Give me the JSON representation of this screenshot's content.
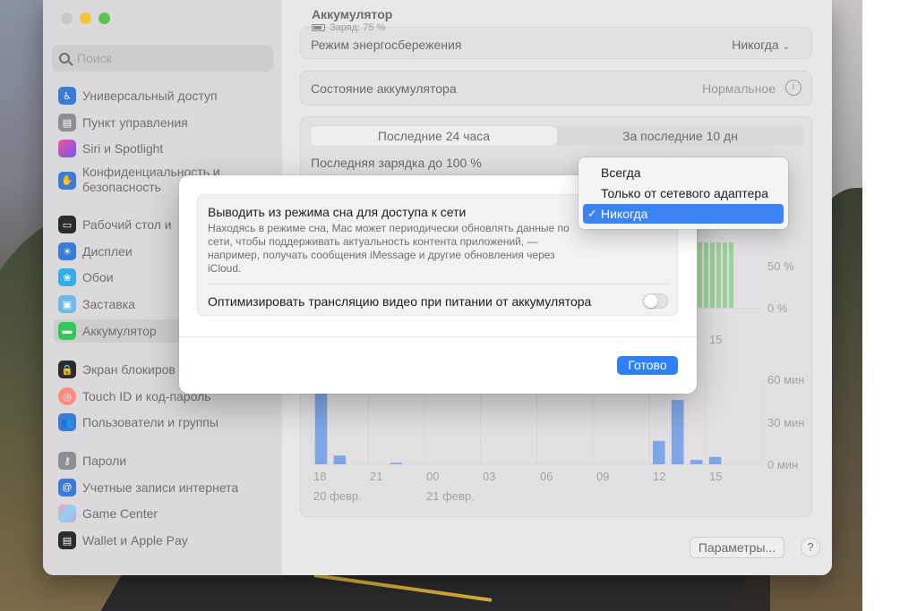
{
  "window": {
    "title": "Аккумулятор",
    "subtitle": "Заряд: 75 %"
  },
  "sidebar": {
    "search_placeholder": "Поиск",
    "items": [
      {
        "label": "Универсальный доступ",
        "icon": "accessibility-icon",
        "color": "#3a7bd5"
      },
      {
        "label": "Пункт управления",
        "icon": "control-center-icon",
        "color": "#8e8e93"
      },
      {
        "label": "Siri и Spotlight",
        "icon": "siri-icon",
        "color": "#b04ad8"
      },
      {
        "label": "Конфиденциальность и безопасность",
        "icon": "hand-icon",
        "color": "#3a7bd5"
      },
      {
        "label": "Рабочий стол и",
        "icon": "desktop-icon",
        "color": "#1c1c1e"
      },
      {
        "label": "Дисплеи",
        "icon": "display-icon",
        "color": "#3a7bd5"
      },
      {
        "label": "Обои",
        "icon": "wallpaper-icon",
        "color": "#32ade6"
      },
      {
        "label": "Заставка",
        "icon": "screensaver-icon",
        "color": "#4fa7e0"
      },
      {
        "label": "Аккумулятор",
        "icon": "battery-icon",
        "color": "#34c759"
      },
      {
        "label": "Экран блокиров",
        "icon": "lock-icon",
        "color": "#1c1c1e"
      },
      {
        "label": "Touch ID и код-пароль",
        "icon": "fingerprint-icon",
        "color": "#ff6961"
      },
      {
        "label": "Пользователи и группы",
        "icon": "users-icon",
        "color": "#3a7bd5"
      },
      {
        "label": "Пароли",
        "icon": "key-icon",
        "color": "#8e8e93"
      },
      {
        "label": "Учетные записи интернета",
        "icon": "at-icon",
        "color": "#3a7bd5"
      },
      {
        "label": "Game Center",
        "icon": "game-center-icon",
        "color": "#e96ca5"
      },
      {
        "label": "Wallet и Apple Pay",
        "icon": "wallet-icon",
        "color": "#1c1c1e"
      }
    ]
  },
  "main": {
    "low_power_label": "Режим энергосбережения",
    "low_power_value": "Никогда",
    "battery_health_label": "Состояние аккумулятора",
    "battery_health_value": "Нормальное",
    "tabs": [
      "Последние 24 часа",
      "За последние 10 дн"
    ],
    "last_charge_label": "Последняя зарядка до 100 %",
    "level_axis": [
      "%",
      "50 %",
      "0 %"
    ],
    "usage_axis": [
      "60 мин",
      "30 мин",
      "0 мин"
    ],
    "time_labels": [
      "18",
      "21",
      "00",
      "03",
      "06",
      "09",
      "12",
      "15"
    ],
    "upper_time_label": "15",
    "date_labels": [
      "20 февр.",
      "21 февр."
    ],
    "options_button": "Параметры...",
    "help_button": "?"
  },
  "chart_data": {
    "type": "bar",
    "title": "",
    "categories": [
      "18",
      "19",
      "20",
      "21",
      "22",
      "23",
      "00",
      "01",
      "02",
      "03",
      "04",
      "05",
      "06",
      "07",
      "08",
      "09",
      "10",
      "11",
      "12",
      "13",
      "14",
      "15"
    ],
    "series": [
      {
        "values": [
          53,
          6,
          0,
          0,
          1,
          0,
          0,
          0,
          0,
          0,
          0,
          0,
          0,
          0,
          0,
          0,
          0,
          0,
          16,
          44,
          3,
          5
        ]
      }
    ],
    "ylabel": "",
    "ylim": [
      0,
      60
    ]
  },
  "sheet": {
    "option1_title": "Выводить из режима сна для доступа к сети",
    "option1_desc": "Находясь в режиме сна, Mac может периодически обновлять данные по сети, чтобы поддерживать актуальность контента приложений, — например, получать сообщения iMessage и другие обновления через iCloud.",
    "option2_title": "Оптимизировать трансляцию видео при питании от аккумулятора",
    "done_button": "Готово"
  },
  "popup_menu": {
    "items": [
      "Всегда",
      "Только от сетевого адаптера",
      "Никогда"
    ],
    "selected_index": 2,
    "check_mark": "✓"
  },
  "colors": {
    "accent": "#2f7ff6",
    "usage_bar": "#7fa6e6",
    "level_bar": "#8fcf8a"
  }
}
